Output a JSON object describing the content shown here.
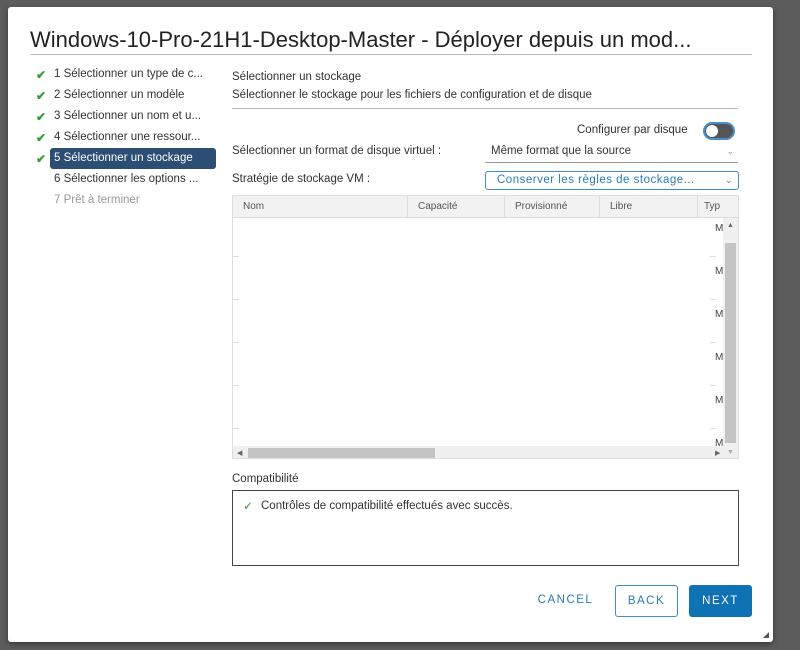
{
  "dialog": {
    "title": "Windows-10-Pro-21H1-Desktop-Master - Déployer depuis un mod..."
  },
  "steps": [
    {
      "label": "1 Sélectionner un type de c...",
      "done": true
    },
    {
      "label": "2 Sélectionner un modèle",
      "done": true
    },
    {
      "label": "3 Sélectionner un nom et u...",
      "done": true
    },
    {
      "label": "4 Sélectionner une ressour...",
      "done": true
    },
    {
      "label": "5 Sélectionner un stockage",
      "done": true,
      "active": true
    },
    {
      "label": "6 Sélectionner les options ...",
      "done": false
    },
    {
      "label": "7 Prêt à terminer",
      "done": false,
      "disabled": true
    }
  ],
  "main": {
    "heading": "Sélectionner un stockage",
    "subheading": "Sélectionner le stockage pour les fichiers de configuration et de disque",
    "per_disk_label": "Configurer par disque",
    "per_disk_on": false,
    "disk_format_label": "Sélectionner un format de disque virtuel :",
    "disk_format_value": "Même format que la source",
    "policy_label": "Stratégie de stockage VM :",
    "policy_value": "Conserver les règles de stockage...",
    "table": {
      "columns": [
        "Nom",
        "Capacité",
        "Provisionné",
        "Libre",
        "Typ"
      ],
      "type_cells": [
        "M",
        "M",
        "M",
        "M",
        "M",
        "M"
      ]
    },
    "compat_label": "Compatibilité",
    "compat_message": "Contrôles de compatibilité effectués avec succès."
  },
  "buttons": {
    "cancel": "CANCEL",
    "back": "BACK",
    "next": "NEXT"
  }
}
